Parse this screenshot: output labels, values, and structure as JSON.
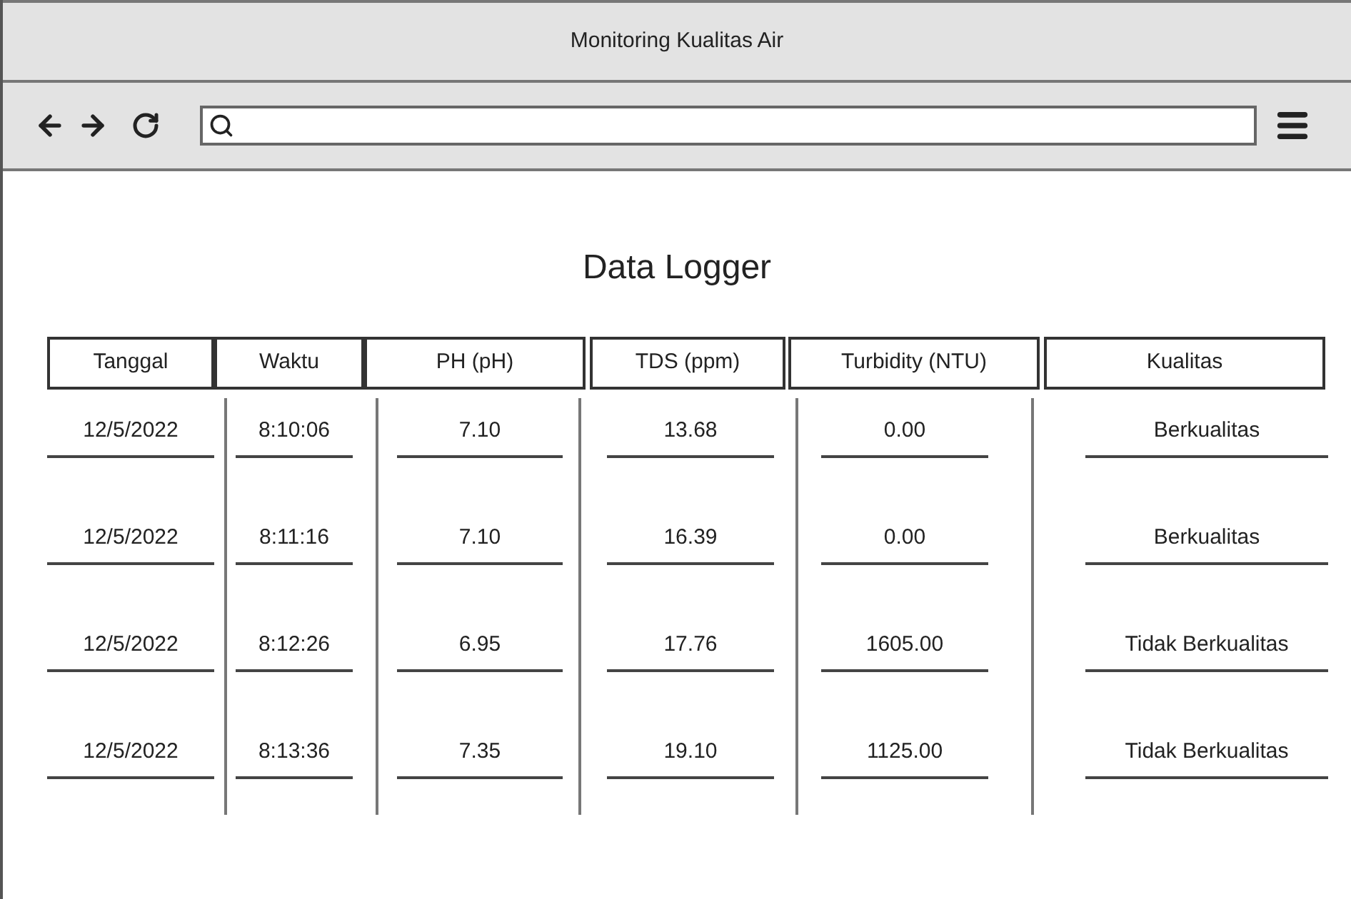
{
  "window": {
    "title": "Monitoring Kualitas Air"
  },
  "page": {
    "title": "Data Logger"
  },
  "table": {
    "columns": [
      "Tanggal",
      "Waktu",
      "PH (pH)",
      "TDS (ppm)",
      "Turbidity (NTU)",
      "Kualitas"
    ],
    "rows": [
      [
        "12/5/2022",
        "8:10:06",
        "7.10",
        "13.68",
        "0.00",
        "Berkualitas"
      ],
      [
        "12/5/2022",
        "8:11:16",
        "7.10",
        "16.39",
        "0.00",
        "Berkualitas"
      ],
      [
        "12/5/2022",
        "8:12:26",
        "6.95",
        "17.76",
        "1605.00",
        "Tidak Berkualitas"
      ],
      [
        "12/5/2022",
        "8:13:36",
        "7.35",
        "19.10",
        "1125.00",
        "Tidak Berkualitas"
      ]
    ]
  }
}
